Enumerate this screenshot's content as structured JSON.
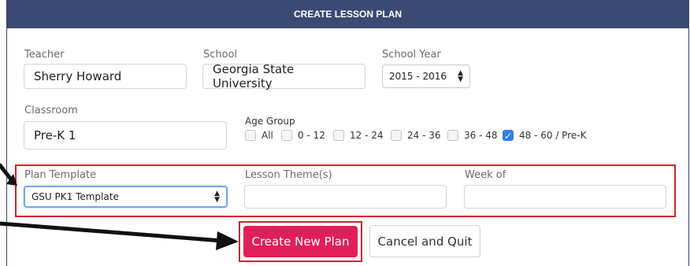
{
  "header": {
    "title": "CREATE LESSON PLAN"
  },
  "form": {
    "teacher": {
      "label": "Teacher",
      "value": "Sherry Howard"
    },
    "school": {
      "label": "School",
      "value": "Georgia State University"
    },
    "school_year": {
      "label": "School Year",
      "selected": "2015 - 2016"
    },
    "classroom": {
      "label": "Classroom",
      "value": "Pre-K 1"
    },
    "age_group": {
      "label": "Age Group",
      "options": [
        {
          "label": "All",
          "checked": false
        },
        {
          "label": "0 - 12",
          "checked": false
        },
        {
          "label": "12 - 24",
          "checked": false
        },
        {
          "label": "24 - 36",
          "checked": false
        },
        {
          "label": "36 - 48",
          "checked": false
        },
        {
          "label": "48 - 60 / Pre-K",
          "checked": true
        }
      ]
    },
    "plan_template": {
      "label": "Plan Template",
      "selected": "GSU PK1 Template"
    },
    "lesson_themes": {
      "label": "Lesson Theme(s)",
      "value": ""
    },
    "week_of": {
      "label": "Week of",
      "value": ""
    }
  },
  "buttons": {
    "create": "Create New Plan",
    "cancel": "Cancel and Quit"
  },
  "colors": {
    "header_bg": "#3b4a73",
    "primary_button": "#e01e5a",
    "highlight_box": "#d2242e",
    "checkbox_checked": "#2f7ee8"
  }
}
